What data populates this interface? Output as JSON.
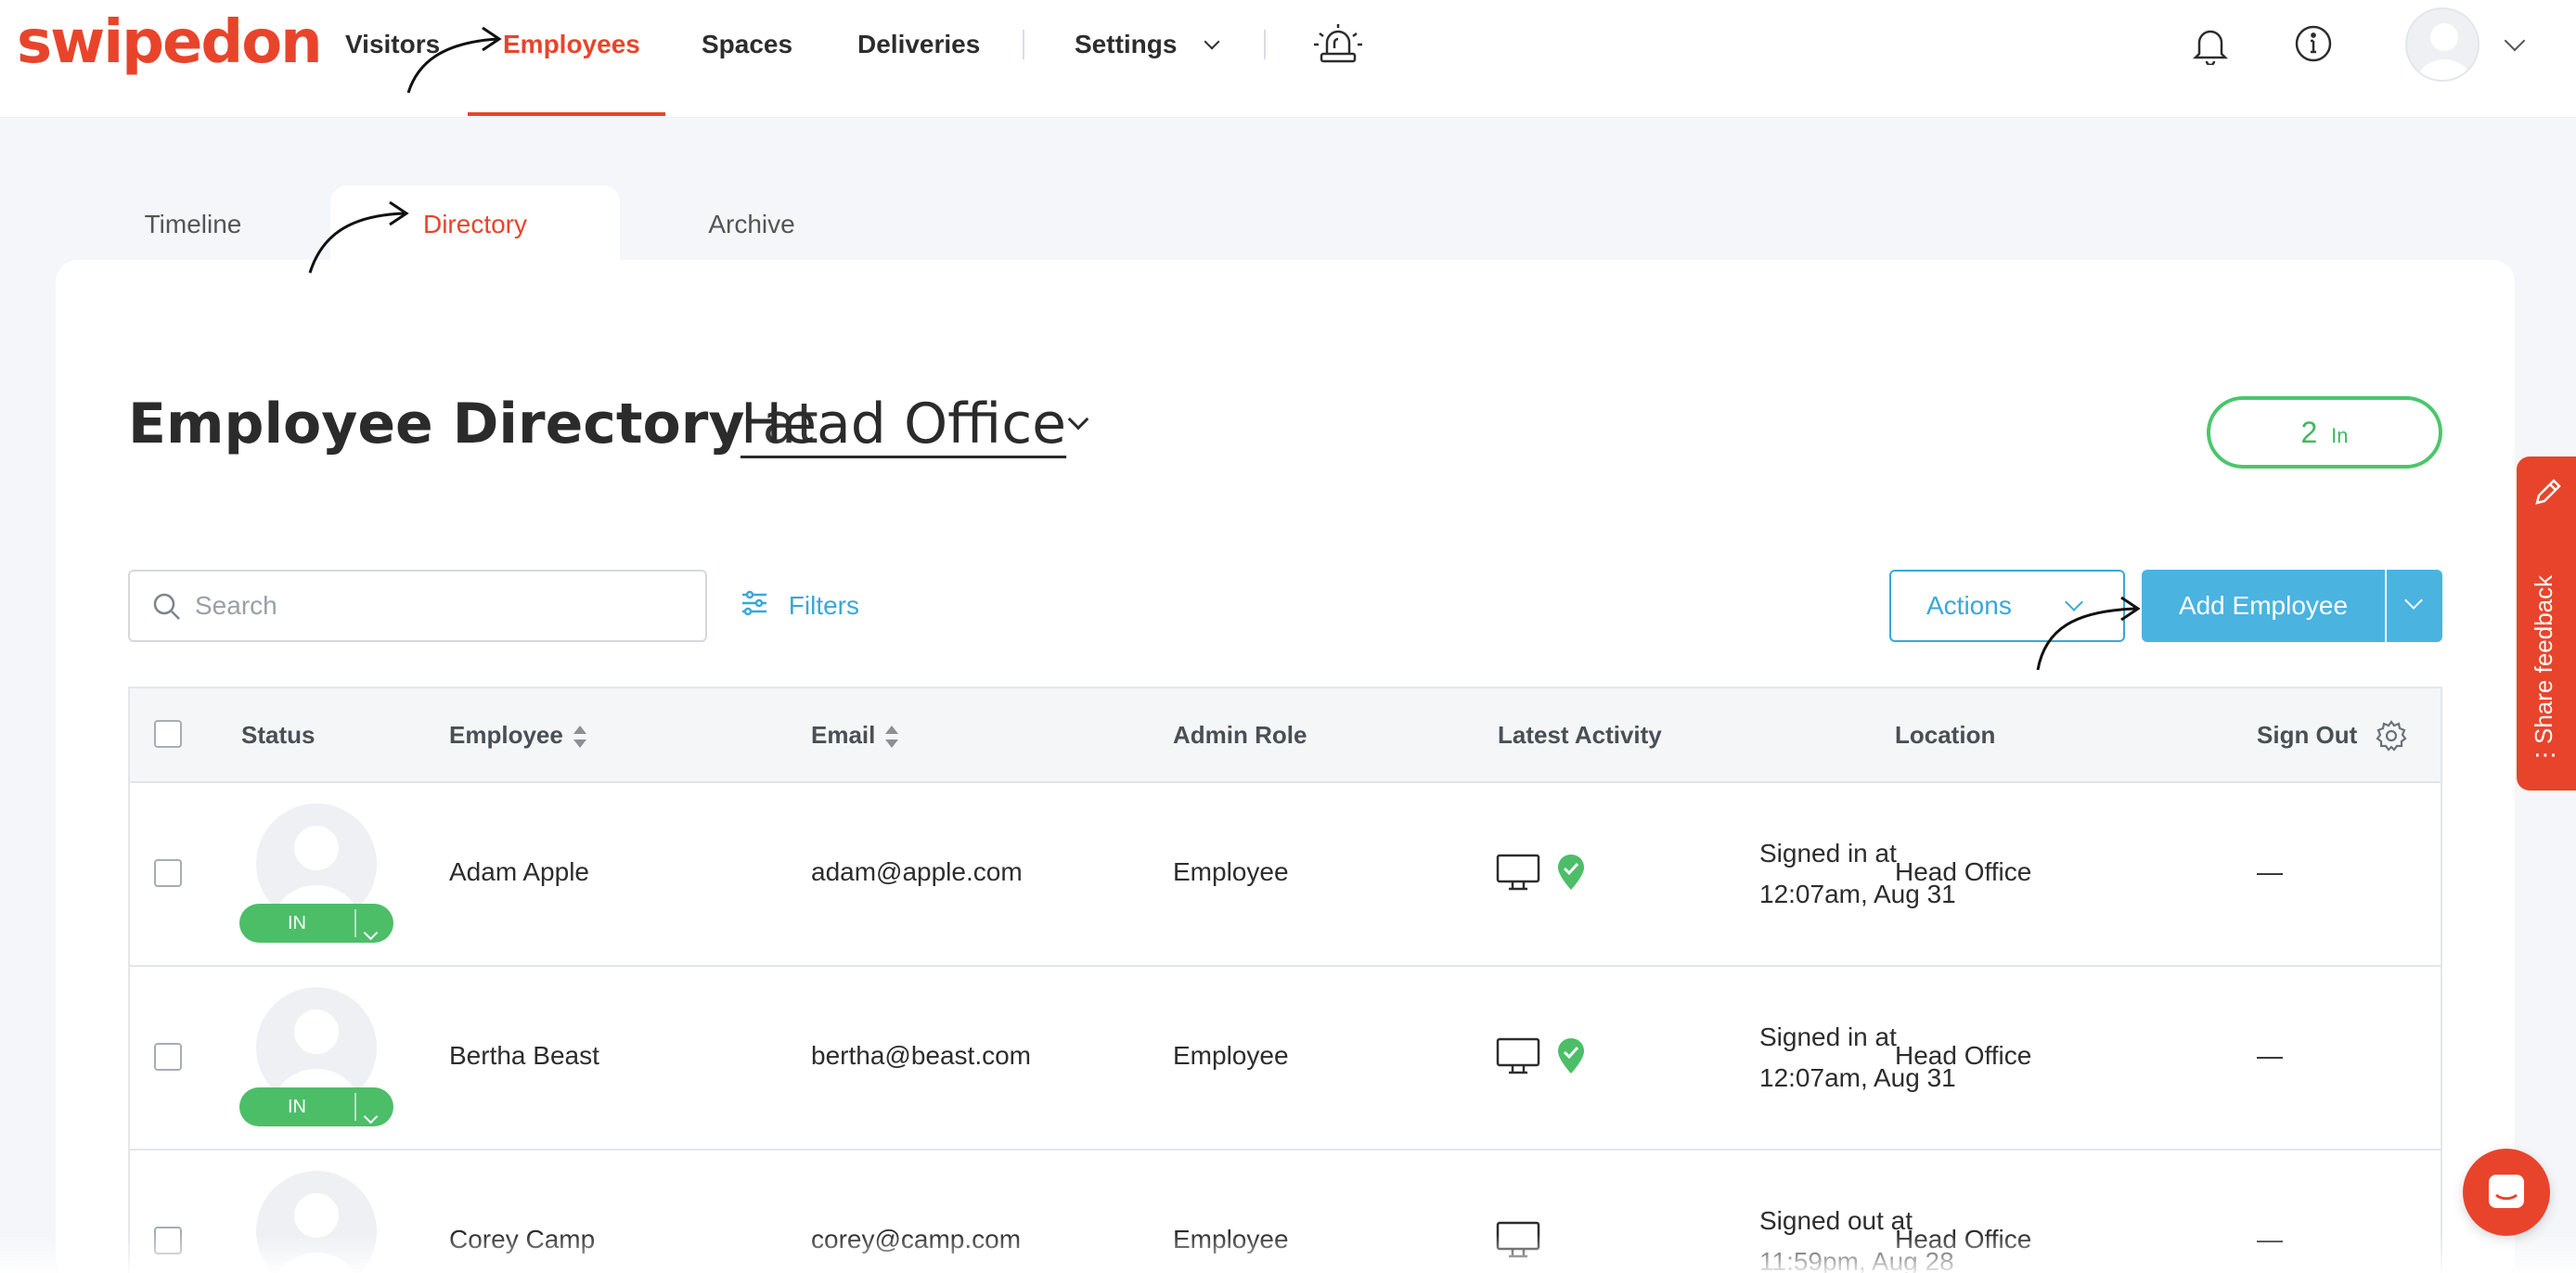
{
  "brand": {
    "name": "swipedon",
    "color": "#e8442b"
  },
  "nav": {
    "items": [
      {
        "label": "Visitors"
      },
      {
        "label": "Employees",
        "active": true
      },
      {
        "label": "Spaces"
      },
      {
        "label": "Deliveries"
      },
      {
        "label": "Settings"
      }
    ],
    "icons": [
      "emergency-alarm-icon",
      "bell-icon",
      "info-icon",
      "user-avatar",
      "chevron-down-icon"
    ]
  },
  "subtabs": [
    {
      "label": "Timeline"
    },
    {
      "label": "Directory",
      "active": true
    },
    {
      "label": "Archive"
    }
  ],
  "header": {
    "title": "Employee Directory",
    "at": "at",
    "location": "Head Office",
    "in_count": "2",
    "in_label": "In"
  },
  "toolbar": {
    "search_placeholder": "Search",
    "filters_label": "Filters",
    "actions_label": "Actions",
    "add_label": "Add Employee"
  },
  "table": {
    "columns": [
      "Status",
      "Employee",
      "Email",
      "Admin Role",
      "Latest Activity",
      "Location",
      "Sign Out"
    ],
    "rows": [
      {
        "status": "IN",
        "name": "Adam Apple",
        "email": "adam@apple.com",
        "role": "Employee",
        "activity_line1": "Signed in at",
        "activity_line2": "12:07am, Aug 31",
        "location": "Head Office",
        "signout": "—"
      },
      {
        "status": "IN",
        "name": "Bertha Beast",
        "email": "bertha@beast.com",
        "role": "Employee",
        "activity_line1": "Signed in at",
        "activity_line2": "12:07am, Aug 31",
        "location": "Head Office",
        "signout": "—"
      },
      {
        "status": "",
        "name": "Corey Camp",
        "email": "corey@camp.com",
        "role": "Employee",
        "activity_line1": "Signed out at",
        "activity_line2": "11:59pm, Aug 28",
        "location": "Head Office",
        "signout": "—"
      }
    ]
  },
  "feedback": {
    "label": "Share feedback"
  },
  "colors": {
    "accent": "#e8442b",
    "link": "#3aa7d6",
    "primary_button": "#4ab3e0",
    "status_in": "#4cbe68"
  }
}
